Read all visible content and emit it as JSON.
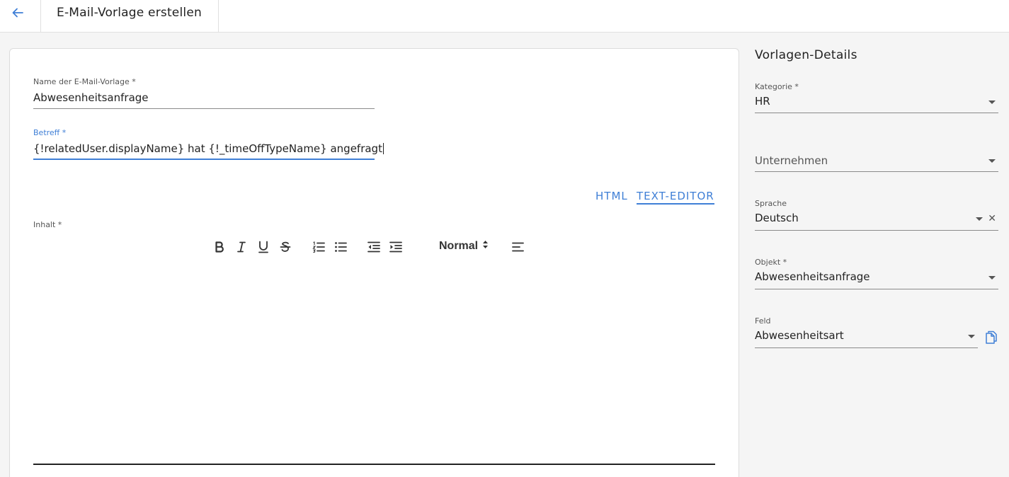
{
  "header": {
    "title": "E-Mail-Vorlage erstellen"
  },
  "form": {
    "name_label": "Name der E-Mail-Vorlage *",
    "name_value": "Abwesenheitsanfrage",
    "subject_label": "Betreff *",
    "subject_value": "{!relatedUser.displayName} hat {!_timeOffTypeName} angefragt",
    "mode_html": "HTML",
    "mode_text_editor": "TEXT-EDITOR",
    "content_label": "Inhalt *"
  },
  "toolbar": {
    "heading_select": "Normal",
    "icons": [
      "bold-icon",
      "italic-icon",
      "underline-icon",
      "strikethrough-icon",
      "ordered-list-icon",
      "bullet-list-icon",
      "outdent-icon",
      "indent-icon",
      "align-icon"
    ]
  },
  "details": {
    "title": "Vorlagen-Details",
    "category_label": "Kategorie *",
    "category_value": "HR",
    "company_placeholder": "Unternehmen",
    "language_label": "Sprache",
    "language_value": "Deutsch",
    "object_label": "Objekt *",
    "object_value": "Abwesenheitsanfrage",
    "field_label": "Feld",
    "field_value": "Abwesenheitsart"
  },
  "colors": {
    "accent": "#3f7fd6",
    "background": "#f5f5f5",
    "card": "#ffffff"
  }
}
